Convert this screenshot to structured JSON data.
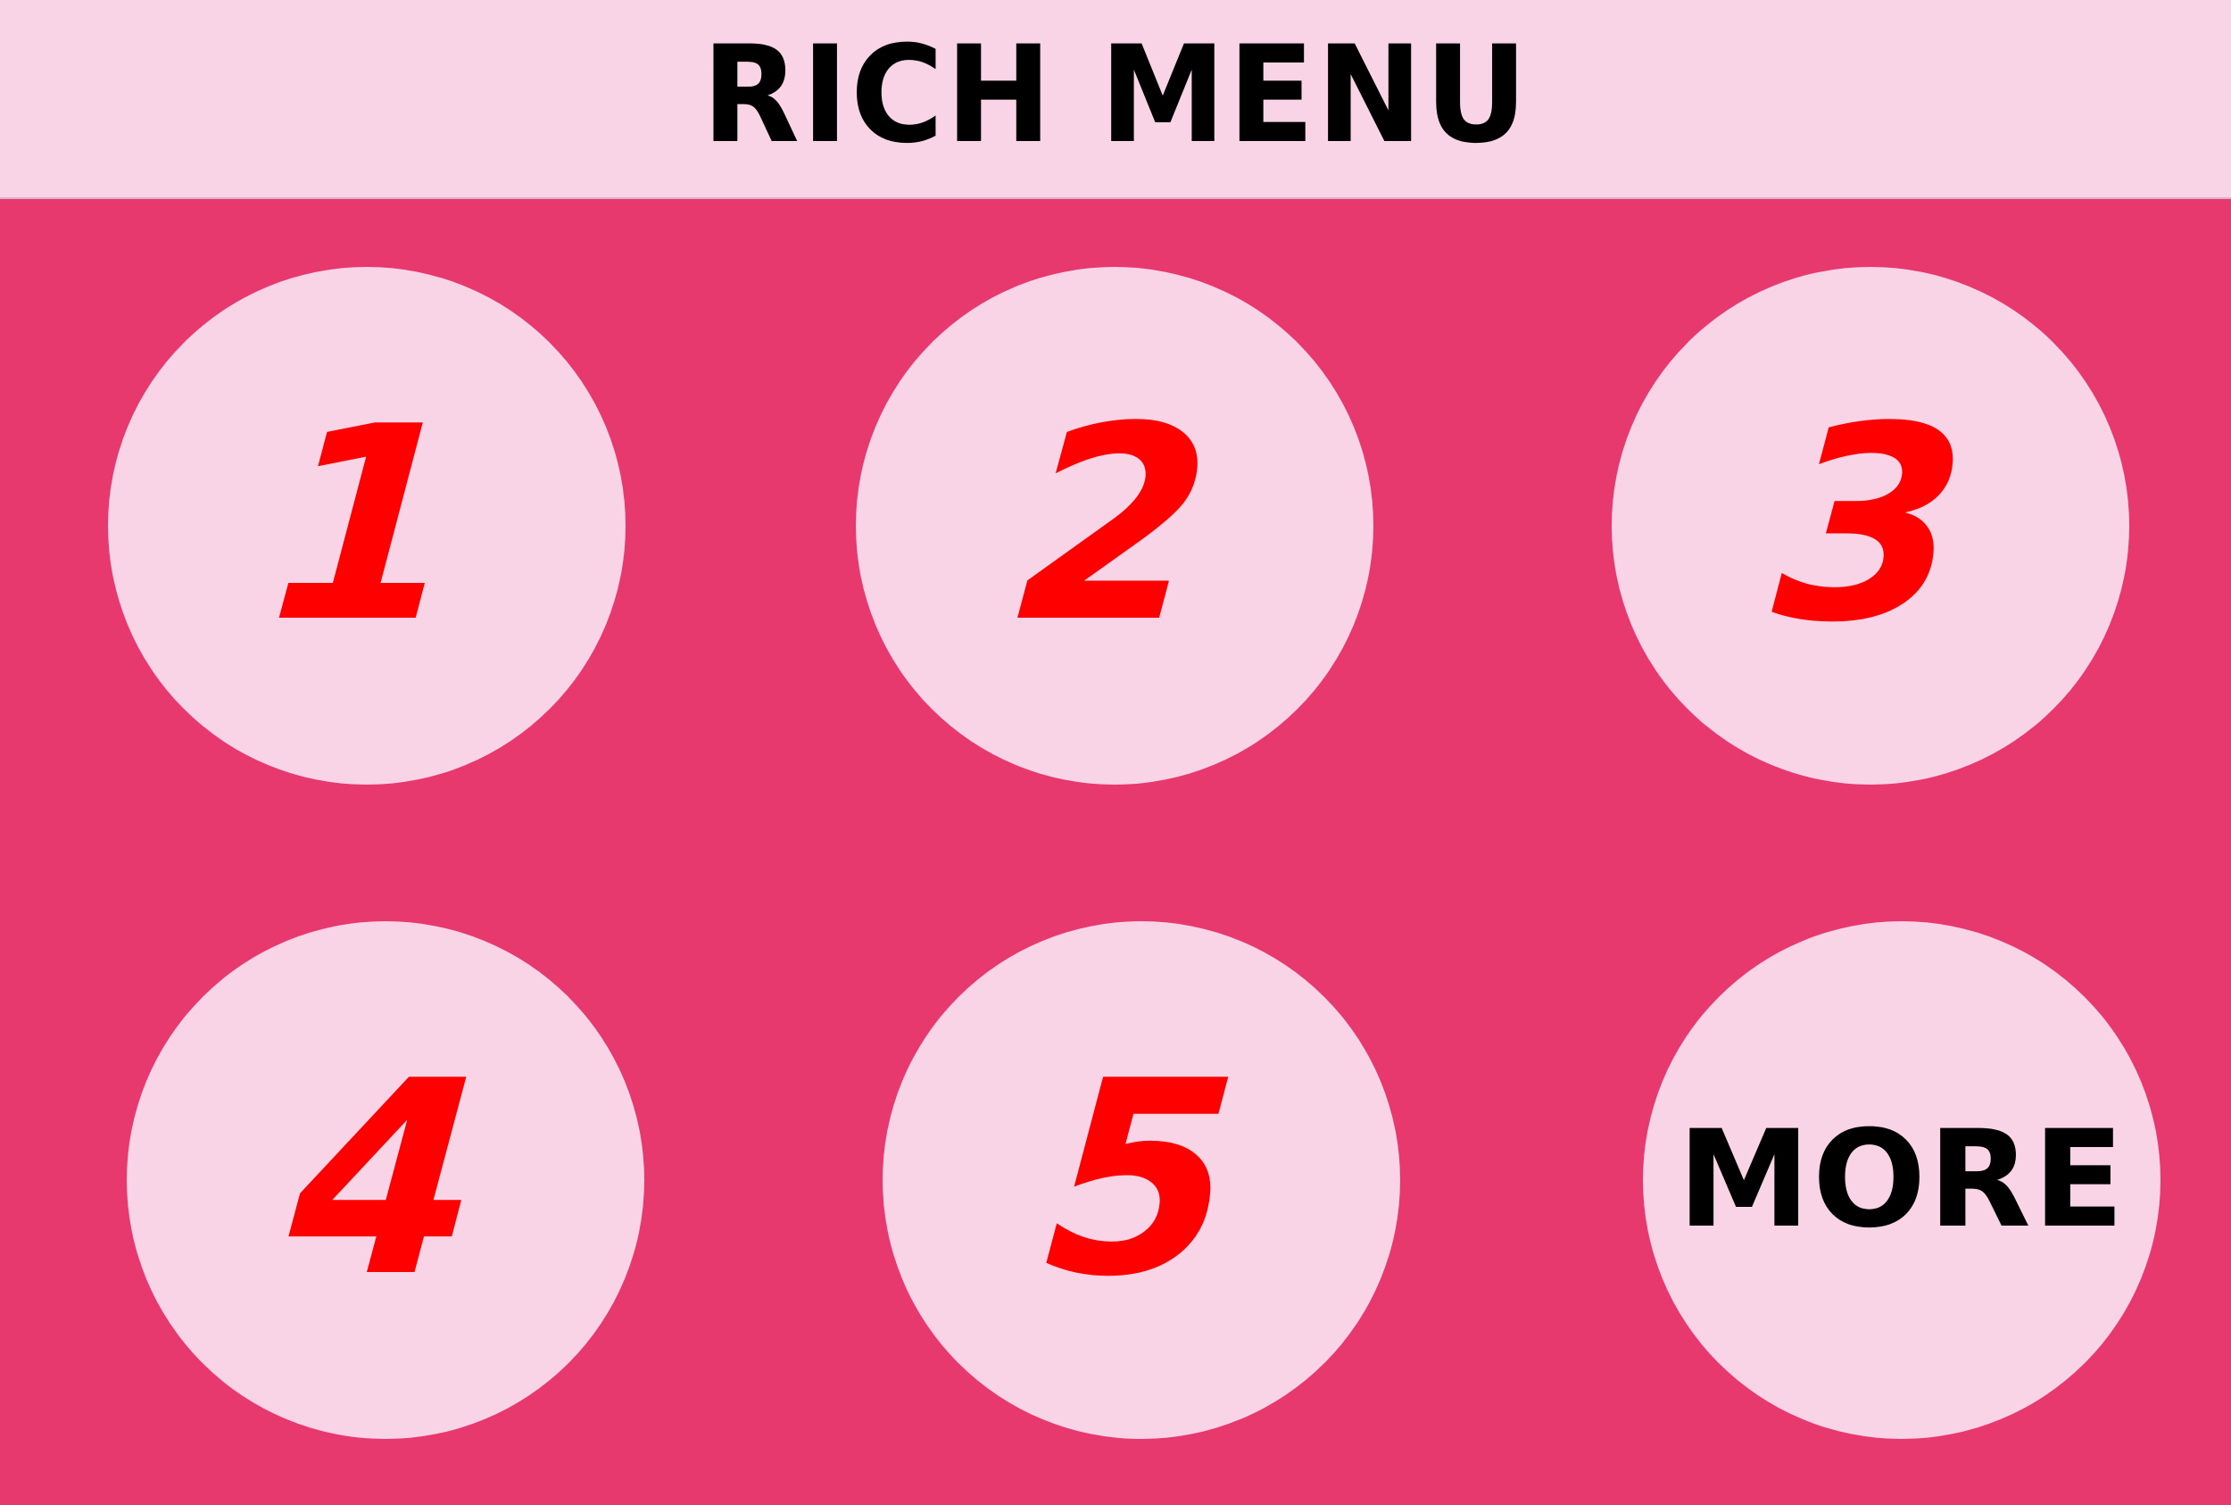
{
  "header": {
    "title": "RICH MENU"
  },
  "colors": {
    "header_bg": "#f9d3e6",
    "panel_bg": "#e8396f",
    "button_bg": "#f9d3e6",
    "number_text": "#ff0000",
    "dark_text": "#000000"
  },
  "menu": {
    "items": [
      {
        "label": "1"
      },
      {
        "label": "2"
      },
      {
        "label": "3"
      },
      {
        "label": "4"
      },
      {
        "label": "5"
      },
      {
        "label": "MORE"
      }
    ]
  }
}
